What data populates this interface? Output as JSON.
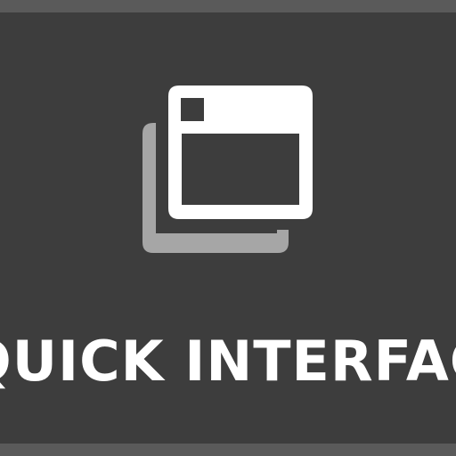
{
  "app": {
    "wordmark": "QUICK INTERFACE"
  },
  "icon": {
    "name": "stacked-windows-icon"
  },
  "colors": {
    "page_border": "#5a5a5a",
    "tile_background": "#3d3d3d",
    "window_front": "#ffffff",
    "window_back": "#a6a6a6",
    "text": "#ffffff"
  }
}
